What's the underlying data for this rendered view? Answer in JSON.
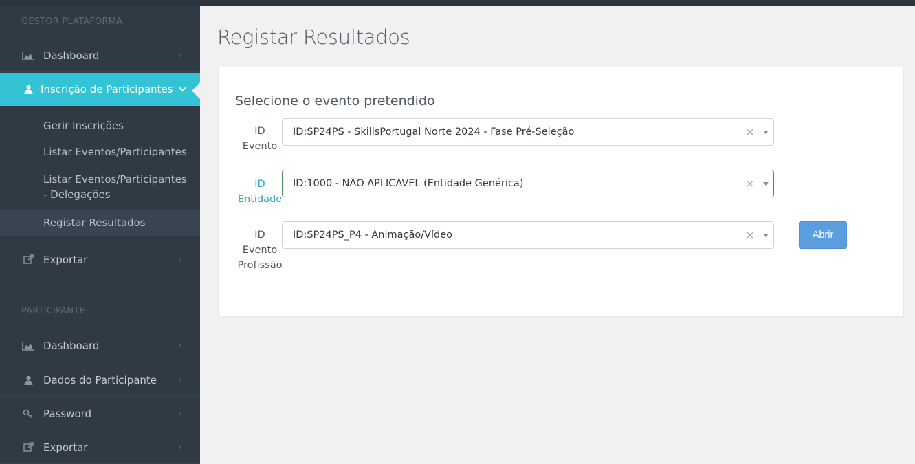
{
  "sidebar": {
    "section1": "GESTOR PLATAFORMA",
    "dashboard": "Dashboard",
    "inscricao": "Inscrição de Participantes",
    "submenu": [
      "Gerir Inscrições",
      "Listar Eventos/Participantes",
      "Listar Eventos/Participantes",
      "- Delegações",
      "Registar Resultados"
    ],
    "exportar": "Exportar",
    "section2": "PARTICIPANTE",
    "dashboard2": "Dashboard",
    "dados": "Dados do Participante",
    "password": "Password",
    "exportar2": "Exportar"
  },
  "main": {
    "title": "Registar Resultados",
    "heading": "Selecione o evento pretendido",
    "fields": [
      {
        "label1": "ID",
        "label2": "Evento",
        "label3": "",
        "value": "ID:SP24PS - SkillsPortugal Norte 2024 - Fase Pré-Seleção"
      },
      {
        "label1": "ID",
        "label2": "Entidade",
        "label3": "",
        "value": "ID:1000 - NÃO APLICÁVEL (Entidade Genérica)"
      },
      {
        "label1": "ID",
        "label2": "Evento",
        "label3": "Profissão",
        "value": "ID:SP24PS_P4 - Animação/Vídeo"
      }
    ],
    "open_button": "Abrir"
  },
  "colors": {
    "accent": "#33c3d4",
    "sidebar": "#2f3a45",
    "button": "#5a9ee0",
    "focus": "#4a8f56"
  }
}
